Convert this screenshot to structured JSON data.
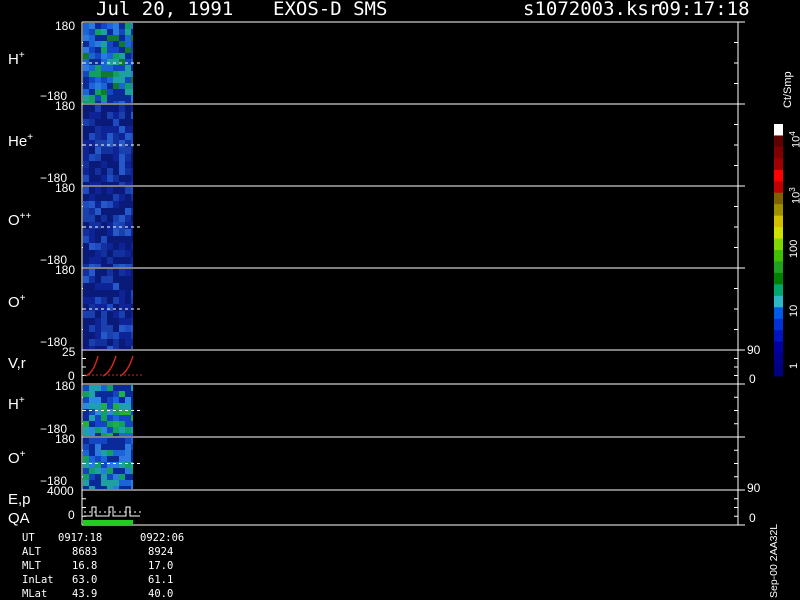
{
  "header": {
    "date": "Jul 20, 1991",
    "title": "EXOS-D SMS",
    "file": "s1072003.ksr",
    "time": "09:17:18"
  },
  "colors": {
    "background": "#000000",
    "axis": "#ffffff",
    "dashed": "#ffffff",
    "line": "#cc2a1a",
    "qa_bar": "#22cc22"
  },
  "panels": [
    {
      "id": "h_plus_1",
      "ion": "H",
      "charge": "+",
      "y_top": "180",
      "y_bot": "−180"
    },
    {
      "id": "he_plus",
      "ion": "He",
      "charge": "+",
      "y_top": "180",
      "y_bot": "−180"
    },
    {
      "id": "o_plusplus",
      "ion": "O",
      "charge": "++",
      "y_top": "180",
      "y_bot": "−180"
    },
    {
      "id": "o_plus_1",
      "ion": "O",
      "charge": "+",
      "y_top": "180",
      "y_bot": "−180"
    },
    {
      "id": "vr",
      "ion": "V,r",
      "charge": "",
      "y_top": "25",
      "y_bot": "0",
      "r_top": "90",
      "r_bot": "0"
    },
    {
      "id": "h_plus_2",
      "ion": "H",
      "charge": "+",
      "y_top": "180",
      "y_bot": "−180"
    },
    {
      "id": "o_plus_2",
      "ion": "O",
      "charge": "+",
      "y_top": "180",
      "y_bot": "−180"
    },
    {
      "id": "ep_qa",
      "ion": "E,p",
      "ion2": "QA",
      "charge": "",
      "y_top": "4000",
      "y_bot": "0",
      "r_top": "90",
      "r_bot": "0"
    }
  ],
  "colorbar": {
    "units": "Ct/Smp",
    "ticks": [
      {
        "base": "10",
        "exp": "4"
      },
      {
        "base": "10",
        "exp": "3"
      },
      {
        "base": "100",
        "exp": ""
      },
      {
        "base": "10",
        "exp": ""
      },
      {
        "base": "1",
        "exp": ""
      }
    ],
    "colors": [
      "#000080",
      "#00008c",
      "#0000a0",
      "#0014c0",
      "#0032d8",
      "#005ce8",
      "#2db8c8",
      "#00a870",
      "#008000",
      "#20a020",
      "#40c000",
      "#80d800",
      "#d0e000",
      "#d0c000",
      "#a09000",
      "#806000",
      "#c00000",
      "#ff0000",
      "#a00000",
      "#800000",
      "#600000",
      "#ffffff"
    ]
  },
  "footer": {
    "labels": [
      "UT",
      "ALT",
      "MLT",
      "InLat",
      "MLat"
    ],
    "col1": [
      "0917:18",
      "8683",
      "16.8",
      "63.0",
      "43.9"
    ],
    "col2": [
      "0922:06",
      "8924",
      "17.0",
      "61.1",
      "40.0"
    ],
    "side_note": "Sep-00  2AA32L"
  },
  "chart_data": {
    "type": "heatmap",
    "time_range": [
      "0917:18",
      "0922:06"
    ],
    "data_coverage": "first 0922:06 portion of plot only (left ~7% of time axis)",
    "angle_range": [
      -180,
      180
    ],
    "vr_range": [
      0,
      25
    ],
    "ep_range": [
      0,
      4000
    ],
    "colorbar_range": [
      1,
      10000
    ],
    "colorbar_scale": "log"
  }
}
